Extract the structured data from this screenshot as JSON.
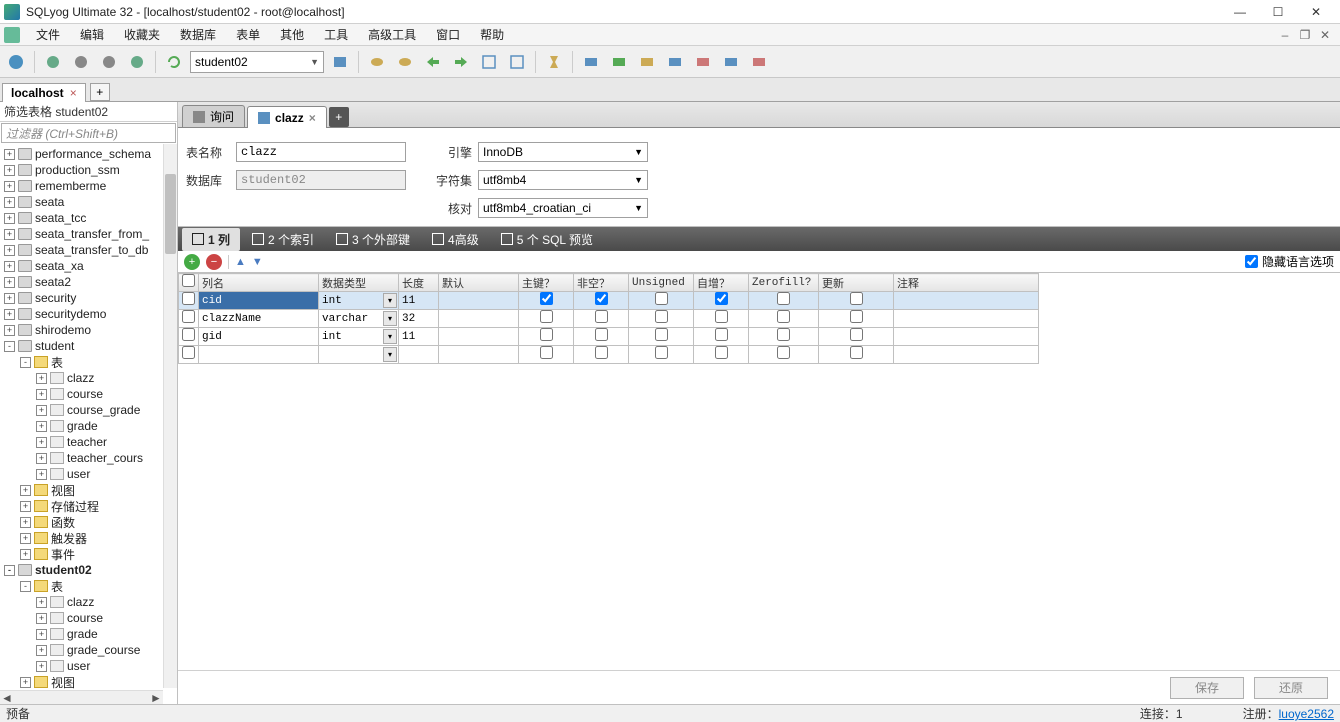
{
  "title": "SQLyog Ultimate 32 - [localhost/student02 - root@localhost]",
  "menu": [
    "文件",
    "编辑",
    "收藏夹",
    "数据库",
    "表单",
    "其他",
    "工具",
    "高级工具",
    "窗口",
    "帮助"
  ],
  "db_selector": "student02",
  "conn_tab": "localhost",
  "filter_head": "筛选表格 student02",
  "filter_placeholder": "过滤器 (Ctrl+Shift+B)",
  "tree": [
    {
      "d": 0,
      "t": "+",
      "k": "db",
      "l": "performance_schema"
    },
    {
      "d": 0,
      "t": "+",
      "k": "db",
      "l": "production_ssm"
    },
    {
      "d": 0,
      "t": "+",
      "k": "db",
      "l": "rememberme"
    },
    {
      "d": 0,
      "t": "+",
      "k": "db",
      "l": "seata"
    },
    {
      "d": 0,
      "t": "+",
      "k": "db",
      "l": "seata_tcc"
    },
    {
      "d": 0,
      "t": "+",
      "k": "db",
      "l": "seata_transfer_from_"
    },
    {
      "d": 0,
      "t": "+",
      "k": "db",
      "l": "seata_transfer_to_db"
    },
    {
      "d": 0,
      "t": "+",
      "k": "db",
      "l": "seata_xa"
    },
    {
      "d": 0,
      "t": "+",
      "k": "db",
      "l": "seata2"
    },
    {
      "d": 0,
      "t": "+",
      "k": "db",
      "l": "security"
    },
    {
      "d": 0,
      "t": "+",
      "k": "db",
      "l": "securitydemo"
    },
    {
      "d": 0,
      "t": "+",
      "k": "db",
      "l": "shirodemo"
    },
    {
      "d": 0,
      "t": "-",
      "k": "db",
      "l": "student"
    },
    {
      "d": 1,
      "t": "-",
      "k": "folder",
      "l": "表"
    },
    {
      "d": 2,
      "t": "+",
      "k": "table",
      "l": "clazz"
    },
    {
      "d": 2,
      "t": "+",
      "k": "table",
      "l": "course"
    },
    {
      "d": 2,
      "t": "+",
      "k": "table",
      "l": "course_grade"
    },
    {
      "d": 2,
      "t": "+",
      "k": "table",
      "l": "grade"
    },
    {
      "d": 2,
      "t": "+",
      "k": "table",
      "l": "teacher"
    },
    {
      "d": 2,
      "t": "+",
      "k": "table",
      "l": "teacher_cours"
    },
    {
      "d": 2,
      "t": "+",
      "k": "table",
      "l": "user"
    },
    {
      "d": 1,
      "t": "+",
      "k": "folder",
      "l": "视图"
    },
    {
      "d": 1,
      "t": "+",
      "k": "folder",
      "l": "存储过程"
    },
    {
      "d": 1,
      "t": "+",
      "k": "folder",
      "l": "函数"
    },
    {
      "d": 1,
      "t": "+",
      "k": "folder",
      "l": "触发器"
    },
    {
      "d": 1,
      "t": "+",
      "k": "folder",
      "l": "事件"
    },
    {
      "d": 0,
      "t": "-",
      "k": "db",
      "l": "student02",
      "b": true
    },
    {
      "d": 1,
      "t": "-",
      "k": "folder",
      "l": "表"
    },
    {
      "d": 2,
      "t": "+",
      "k": "table",
      "l": "clazz"
    },
    {
      "d": 2,
      "t": "+",
      "k": "table",
      "l": "course"
    },
    {
      "d": 2,
      "t": "+",
      "k": "table",
      "l": "grade"
    },
    {
      "d": 2,
      "t": "+",
      "k": "table",
      "l": "grade_course"
    },
    {
      "d": 2,
      "t": "+",
      "k": "table",
      "l": "user"
    },
    {
      "d": 1,
      "t": "+",
      "k": "folder",
      "l": "视图"
    }
  ],
  "ed_tabs": [
    {
      "label": "询问",
      "active": false,
      "closable": false
    },
    {
      "label": "clazz",
      "active": true,
      "closable": true
    }
  ],
  "form": {
    "labels": {
      "name": "表名称",
      "db": "数据库",
      "engine": "引擎",
      "charset": "字符集",
      "collation": "核对"
    },
    "name": "clazz",
    "db": "student02",
    "engine": "InnoDB",
    "charset": "utf8mb4",
    "collation": "utf8mb4_croatian_ci"
  },
  "subtabs": [
    "1 列",
    "2 个索引",
    "3 个外部键",
    "4高级",
    "5 个 SQL 预览"
  ],
  "hide_lang": "隐藏语言选项",
  "grid": {
    "headers": [
      "列名",
      "数据类型",
      "长度",
      "默认",
      "主键？",
      "非空？",
      "Unsigned",
      "自增？",
      "Zerofill?",
      "更新",
      "注释"
    ],
    "rows": [
      {
        "name": "cid",
        "type": "int",
        "len": "11",
        "def": "",
        "pk": true,
        "nn": true,
        "us": false,
        "ai": true,
        "zf": false,
        "up": false,
        "cm": "",
        "sel": true
      },
      {
        "name": "clazzName",
        "type": "varchar",
        "len": "32",
        "def": "",
        "pk": false,
        "nn": false,
        "us": false,
        "ai": false,
        "zf": false,
        "up": false,
        "cm": ""
      },
      {
        "name": "gid",
        "type": "int",
        "len": "11",
        "def": "",
        "pk": false,
        "nn": false,
        "us": false,
        "ai": false,
        "zf": false,
        "up": false,
        "cm": ""
      },
      {
        "name": "",
        "type": "",
        "len": "",
        "def": "",
        "pk": false,
        "nn": false,
        "us": false,
        "ai": false,
        "zf": false,
        "up": false,
        "cm": "",
        "empty": true
      }
    ]
  },
  "footer": {
    "save": "保存",
    "revert": "还原"
  },
  "status": {
    "left": "预备",
    "conn": "连接：1",
    "reg_label": "注册：",
    "reg_user": "luoye2562"
  }
}
